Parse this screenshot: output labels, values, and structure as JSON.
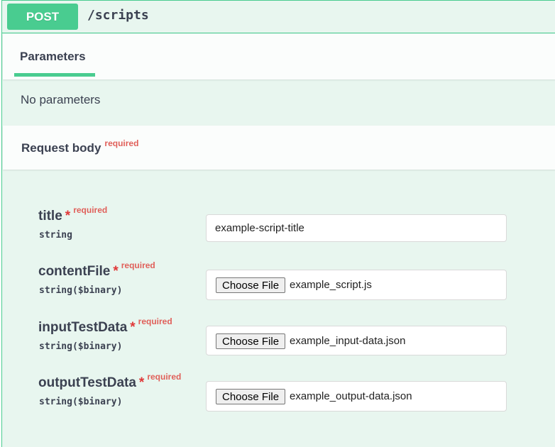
{
  "operation": {
    "method": "POST",
    "path": "/scripts"
  },
  "tabs": {
    "parameters_label": "Parameters"
  },
  "parameters": {
    "empty_text": "No parameters"
  },
  "request_body": {
    "title": "Request body",
    "required_label": "required",
    "fields": [
      {
        "name": "title",
        "star": "*",
        "required": "required",
        "type": "string",
        "value": "example-script-title"
      },
      {
        "name": "contentFile",
        "star": "*",
        "required": "required",
        "type": "string($binary)",
        "button": "Choose File",
        "file": "example_script.js"
      },
      {
        "name": "inputTestData",
        "star": "*",
        "required": "required",
        "type": "string($binary)",
        "button": "Choose File",
        "file": "example_input-data.json"
      },
      {
        "name": "outputTestData",
        "star": "*",
        "required": "required",
        "type": "string($binary)",
        "button": "Choose File",
        "file": "example_output-data.json"
      }
    ]
  },
  "colors": {
    "accent": "#49cc90",
    "background": "#e8f6ef",
    "required": "#e0605a"
  }
}
